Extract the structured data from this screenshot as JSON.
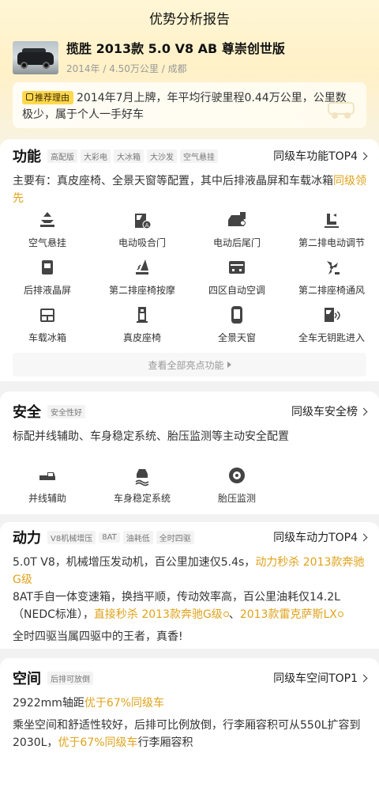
{
  "page_title": "优势分析报告",
  "car": {
    "name": "揽胜 2013款 5.0 V8 AB 尊崇创世版",
    "meta": "2014年 / 4.50万公里 / 成都"
  },
  "recommend": {
    "tag": "推荐理由",
    "text": "2014年7月上牌，年平均行驶里程0.44万公里，公里数极少，属于个人一手好车"
  },
  "function": {
    "title": "功能",
    "tags": [
      "高配版",
      "大彩电",
      "大冰箱",
      "大沙发",
      "空气悬挂"
    ],
    "rank": "同级车功能TOP4",
    "desc": "主要有：真皮座椅、全景天窗等配置，其中后排液晶屏和车载冰箱",
    "desc_hl": "同级领先",
    "features": [
      {
        "label": "空气悬挂",
        "icon": "air-suspension-icon"
      },
      {
        "label": "电动吸合门",
        "icon": "soft-close-door-icon"
      },
      {
        "label": "电动后尾门",
        "icon": "power-tailgate-icon"
      },
      {
        "label": "第二排电动调节",
        "icon": "power-seat-icon"
      },
      {
        "label": "后排液晶屏",
        "icon": "rear-screen-icon"
      },
      {
        "label": "第二排座椅按摩",
        "icon": "seat-massage-icon"
      },
      {
        "label": "四区自动空调",
        "icon": "climate-control-icon"
      },
      {
        "label": "第二排座椅通风",
        "icon": "seat-ventilation-icon"
      },
      {
        "label": "车载冰箱",
        "icon": "fridge-icon"
      },
      {
        "label": "真皮座椅",
        "icon": "leather-seat-icon"
      },
      {
        "label": "全景天窗",
        "icon": "panoramic-sunroof-icon"
      },
      {
        "label": "全车无钥匙进入",
        "icon": "keyless-entry-icon"
      }
    ],
    "more": "查看全部亮点功能"
  },
  "safety": {
    "title": "安全",
    "tags": [
      "安全性好"
    ],
    "rank": "同级车安全榜",
    "desc": "标配并线辅助、车身稳定系统、胎压监测等主动安全配置",
    "features": [
      {
        "label": "并线辅助",
        "icon": "lane-assist-icon"
      },
      {
        "label": "车身稳定系统",
        "icon": "stability-control-icon"
      },
      {
        "label": "胎压监测",
        "icon": "tire-pressure-icon"
      }
    ]
  },
  "power": {
    "title": "动力",
    "tags": [
      "V8机械增压",
      "8AT",
      "油耗低",
      "全时四驱"
    ],
    "rank": "同级车动力TOP4",
    "p1": "5.0T V8，机械增压发动机，百公里加速仅5.4s，",
    "p1_hl": "动力秒杀 2013款奔驰G级",
    "p2": "8AT手自一体变速箱，换挡平顺，传动效率高，百公里油耗仅14.2L（NEDC标准），",
    "p2_hl1": "直接秒杀 2013款奔驰G级",
    "p2_sep": "、",
    "p2_hl2": "2013款雷克萨斯LX",
    "p3": "全时四驱当属四驱中的王者，真香!"
  },
  "space": {
    "title": "空间",
    "tags": [
      "后排可放倒"
    ],
    "rank": "同级车空间TOP1",
    "p1": "2922mm轴距",
    "p1_hl": "优于67%同级车",
    "p2": "乘坐空间和舒适性较好，后排可比例放倒，行李厢容积可从550L扩容到2030L，",
    "p2_hl": "优于67%同级车",
    "p2_tail": "行李厢容积"
  }
}
